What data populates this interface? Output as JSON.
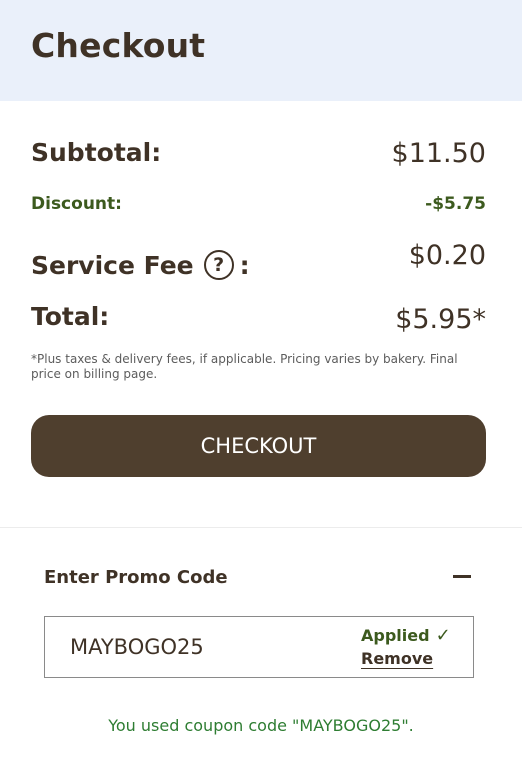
{
  "header": {
    "title": "Checkout"
  },
  "summary": {
    "subtotal_label": "Subtotal:",
    "subtotal_value": "$11.50",
    "discount_label": "Discount:",
    "discount_value": "-$5.75",
    "fee_label": "Service Fee",
    "fee_icon": "?",
    "fee_colon": ":",
    "fee_value": "$0.20",
    "total_label": "Total:",
    "total_value": "$5.95*",
    "note": "*Plus taxes & delivery fees, if applicable. Pricing varies by bakery. Final price on billing page."
  },
  "checkout_button": {
    "label": "CHECKOUT"
  },
  "promo": {
    "title": "Enter Promo Code",
    "toggle_icon": "minus-icon",
    "code_value": "MAYBOGO25",
    "applied_label": "Applied",
    "check_icon": "✓",
    "remove_label": "Remove",
    "message": "You used coupon code \"MAYBOGO25\"."
  },
  "colors": {
    "header_bg": "#eaf0fa",
    "text_brown": "#3f3226",
    "button_bg": "#4f3f2e",
    "discount_green": "#3c5a1e",
    "success_green": "#2e7d32"
  }
}
